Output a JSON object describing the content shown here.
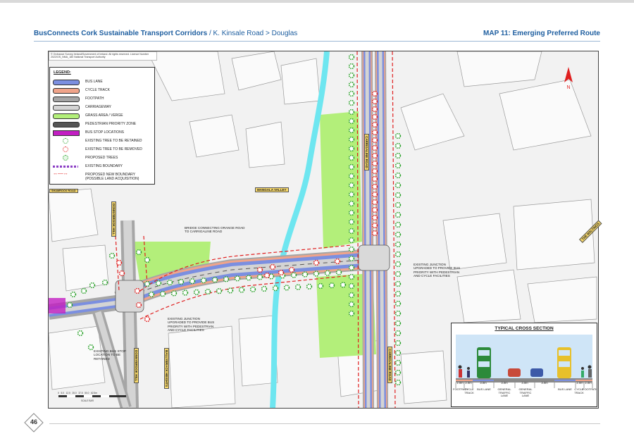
{
  "header": {
    "title_bold": "BusConnects Cork Sustainable Transport Corridors",
    "title_rest": " / K. Kinsale Road > Douglas",
    "map_title": "MAP 11: Emerging Preferred Route"
  },
  "copyright": "© Ordnance Survey Ireland/Government of Ireland. All rights reserved. Licence Number 2022/OS_NMA_180 National Transport Authority",
  "legend": {
    "title": "LEGEND:",
    "items": [
      {
        "label": "BUS LANE",
        "color": "#7b8fe0"
      },
      {
        "label": "CYCLE TRACK",
        "color": "#f0a48a"
      },
      {
        "label": "FOOTPATH",
        "color": "#a6a6a6"
      },
      {
        "label": "CARRIAGEWAY",
        "color": "#d4d4d4"
      },
      {
        "label": "GRASS AREA / VERGE",
        "color": "#b3ef7a"
      },
      {
        "label": "PEDESTRIAN PRIORITY ZONE",
        "color": "#555555"
      },
      {
        "label": "BUS STOP LOCATIONS",
        "color": "#c21ec2"
      },
      {
        "label": "EXISTING TREE TO BE RETAINED",
        "color": "#2aa02a"
      },
      {
        "label": "EXISTING TREE TO BE REMOVED",
        "color": "#e02020"
      },
      {
        "label": "PROPOSED TREES",
        "color": "#2aa02a"
      },
      {
        "label": "EXISTING BOUNDARY",
        "color": "#8a3dc4"
      },
      {
        "label": "PROPOSED NEW BOUNDARY",
        "label2": "(POSSIBLE LAND ACQUISITION)",
        "color": "#e02020"
      }
    ]
  },
  "annotations": {
    "bridge": "BRIDGE CONNECTING ORANGE ROAD TO CARRIGALINE ROAD",
    "junction_east": "EXISTING JUNCTION UPGRADED TO PROVIDE BUS PRIORITY WITH PEDESTRIAN AND CYCLE FACILITIES",
    "junction_west": "EXISTING JUNCTION UPGRADED TO PROVIDE BUS PRIORITY WITH PEDESTRIAN AND CYCLE FACILITIES",
    "bus_stop": "EXISTING BUS STOP LOCATION TO BE RETAINED"
  },
  "road_labels": {
    "mangala": "MANGALA VALLEY",
    "shamrock": "SHAMROCK ROAD",
    "donnybrook_hill_top": "DONNYBROOK HILL",
    "donnybrook_hill_bottom": "DONNYBROOK HILL",
    "carrigaline_top": "CARRIGALINE ROAD",
    "carrigaline_bottom": "CARRIGALINE ROAD",
    "ballybrack": "BALLYBRACK HEIGHTS",
    "the_maltings": "THE MALTINGS"
  },
  "scale": {
    "ticks": [
      "0",
      "5.0",
      "12.5",
      "25.0",
      "37.5",
      "50.0",
      "62.5m"
    ],
    "label": "SCALE BAR"
  },
  "cross_section": {
    "title": "TYPICAL CROSS SECTION",
    "widths": [
      "2.0m",
      "2.0m",
      "3.0m",
      "3.0m",
      "3.0m",
      "3.0m",
      "2.0m",
      "2.0m"
    ],
    "labels": [
      "FOOTPATH",
      "CYCLE TRACK",
      "BUS LANE",
      "GENERAL TRAFFIC LANE",
      "GENERAL TRAFFIC LANE",
      "BUS LANE",
      "CYCLE TRACK",
      "FOOTPATH"
    ]
  },
  "page_number": "46"
}
